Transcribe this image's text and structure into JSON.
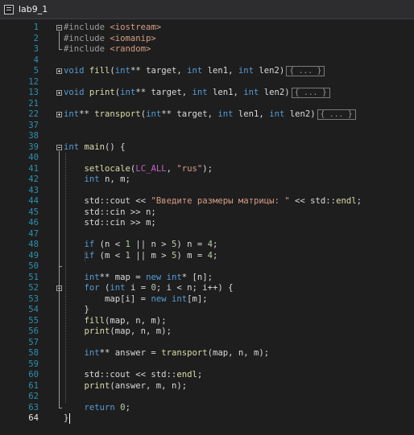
{
  "tab": {
    "title": "lab9_1",
    "icon": "cpp-file-icon"
  },
  "lines": [
    {
      "n": "1",
      "fold": "minus",
      "tokens": [
        [
          "pp",
          "#include "
        ],
        [
          "str",
          "<iostream>"
        ]
      ]
    },
    {
      "n": "2",
      "tokens": [
        [
          "pp",
          "#include "
        ],
        [
          "str",
          "<iomanip>"
        ]
      ]
    },
    {
      "n": "3",
      "tokens": [
        [
          "pp",
          "#include "
        ],
        [
          "str",
          "<random>"
        ]
      ]
    },
    {
      "n": "4",
      "tokens": []
    },
    {
      "n": "5",
      "fold": "plus",
      "tokens": [
        [
          "kw",
          "void "
        ],
        [
          "fn",
          "fill"
        ],
        [
          "id",
          "("
        ],
        [
          "kw",
          "int"
        ],
        [
          "id",
          "** target, "
        ],
        [
          "kw",
          "int"
        ],
        [
          "id",
          " len1, "
        ],
        [
          "kw",
          "int"
        ],
        [
          "id",
          " len2)"
        ],
        [
          "collapsed",
          "{ ... }"
        ]
      ]
    },
    {
      "n": "12",
      "tokens": []
    },
    {
      "n": "13",
      "fold": "plus",
      "tokens": [
        [
          "kw",
          "void "
        ],
        [
          "fn",
          "print"
        ],
        [
          "id",
          "("
        ],
        [
          "kw",
          "int"
        ],
        [
          "id",
          "** target, "
        ],
        [
          "kw",
          "int"
        ],
        [
          "id",
          " len1, "
        ],
        [
          "kw",
          "int"
        ],
        [
          "id",
          " len2)"
        ],
        [
          "collapsed",
          "{ ... }"
        ]
      ]
    },
    {
      "n": "21",
      "tokens": []
    },
    {
      "n": "22",
      "fold": "plus",
      "tokens": [
        [
          "kw",
          "int"
        ],
        [
          "id",
          "** "
        ],
        [
          "fn",
          "transport"
        ],
        [
          "id",
          "("
        ],
        [
          "kw",
          "int"
        ],
        [
          "id",
          "** target, "
        ],
        [
          "kw",
          "int"
        ],
        [
          "id",
          " len1, "
        ],
        [
          "kw",
          "int"
        ],
        [
          "id",
          " len2)"
        ],
        [
          "collapsed",
          "{ ... }"
        ]
      ]
    },
    {
      "n": "37",
      "tokens": []
    },
    {
      "n": "38",
      "tokens": []
    },
    {
      "n": "39",
      "fold": "minus",
      "tokens": [
        [
          "kw",
          "int "
        ],
        [
          "fn",
          "main"
        ],
        [
          "id",
          "() {"
        ]
      ]
    },
    {
      "n": "40",
      "tokens": []
    },
    {
      "n": "41",
      "tokens": [
        [
          "id",
          "    "
        ],
        [
          "fn",
          "setlocale"
        ],
        [
          "id",
          "("
        ],
        [
          "mac",
          "LC_ALL"
        ],
        [
          "id",
          ", "
        ],
        [
          "str",
          "\"rus\""
        ],
        [
          "id",
          ");"
        ]
      ]
    },
    {
      "n": "42",
      "tokens": [
        [
          "id",
          "    "
        ],
        [
          "kw",
          "int "
        ],
        [
          "id",
          "n, m;"
        ]
      ]
    },
    {
      "n": "43",
      "tokens": []
    },
    {
      "n": "44",
      "tokens": [
        [
          "id",
          "    std::"
        ],
        [
          "id",
          "cout << "
        ],
        [
          "str",
          "\"Введите размеры матрицы: \""
        ],
        [
          "id",
          " << std::"
        ],
        [
          "fn",
          "endl"
        ],
        [
          "id",
          ";"
        ]
      ]
    },
    {
      "n": "45",
      "tokens": [
        [
          "id",
          "    std::cin >> n;"
        ]
      ]
    },
    {
      "n": "46",
      "tokens": [
        [
          "id",
          "    std::cin >> m;"
        ]
      ]
    },
    {
      "n": "47",
      "tokens": []
    },
    {
      "n": "48",
      "tokens": [
        [
          "id",
          "    "
        ],
        [
          "kw",
          "if "
        ],
        [
          "id",
          "(n < "
        ],
        [
          "num",
          "1"
        ],
        [
          "id",
          " || n > "
        ],
        [
          "num",
          "5"
        ],
        [
          "id",
          ") n = "
        ],
        [
          "num",
          "4"
        ],
        [
          "id",
          ";"
        ]
      ]
    },
    {
      "n": "49",
      "tokens": [
        [
          "id",
          "    "
        ],
        [
          "kw",
          "if "
        ],
        [
          "id",
          "(m < "
        ],
        [
          "num",
          "1"
        ],
        [
          "id",
          " || m > "
        ],
        [
          "num",
          "5"
        ],
        [
          "id",
          ") m = "
        ],
        [
          "num",
          "4"
        ],
        [
          "id",
          ";"
        ]
      ]
    },
    {
      "n": "50",
      "tokens": []
    },
    {
      "n": "51",
      "tokens": [
        [
          "id",
          "    "
        ],
        [
          "kw",
          "int"
        ],
        [
          "id",
          "** map = "
        ],
        [
          "kw",
          "new int"
        ],
        [
          "id",
          "* [n];"
        ]
      ]
    },
    {
      "n": "52",
      "fold": "minus",
      "tokens": [
        [
          "id",
          "    "
        ],
        [
          "kw",
          "for "
        ],
        [
          "id",
          "("
        ],
        [
          "kw",
          "int"
        ],
        [
          "id",
          " i = "
        ],
        [
          "num",
          "0"
        ],
        [
          "id",
          "; i < n; i++) {"
        ]
      ]
    },
    {
      "n": "53",
      "tokens": [
        [
          "id",
          "        map[i] = "
        ],
        [
          "kw",
          "new int"
        ],
        [
          "id",
          "[m];"
        ]
      ]
    },
    {
      "n": "54",
      "tokens": [
        [
          "id",
          "    }"
        ]
      ]
    },
    {
      "n": "55",
      "tokens": [
        [
          "id",
          "    "
        ],
        [
          "fn",
          "fill"
        ],
        [
          "id",
          "(map, n, m);"
        ]
      ]
    },
    {
      "n": "56",
      "tokens": [
        [
          "id",
          "    "
        ],
        [
          "fn",
          "print"
        ],
        [
          "id",
          "(map, n, m);"
        ]
      ]
    },
    {
      "n": "57",
      "tokens": []
    },
    {
      "n": "58",
      "tokens": [
        [
          "id",
          "    "
        ],
        [
          "kw",
          "int"
        ],
        [
          "id",
          "** answer = "
        ],
        [
          "fn",
          "transport"
        ],
        [
          "id",
          "(map, n, m);"
        ]
      ]
    },
    {
      "n": "59",
      "tokens": []
    },
    {
      "n": "60",
      "tokens": [
        [
          "id",
          "    std::cout << std::"
        ],
        [
          "fn",
          "endl"
        ],
        [
          "id",
          ";"
        ]
      ]
    },
    {
      "n": "61",
      "tokens": [
        [
          "id",
          "    "
        ],
        [
          "fn",
          "print"
        ],
        [
          "id",
          "(answer, m, n);"
        ]
      ]
    },
    {
      "n": "62",
      "tokens": []
    },
    {
      "n": "63",
      "tokens": [
        [
          "id",
          "    "
        ],
        [
          "kw",
          "return "
        ],
        [
          "num",
          "0"
        ],
        [
          "id",
          ";"
        ]
      ]
    },
    {
      "n": "64",
      "current": true,
      "tokens": [
        [
          "id",
          "}"
        ]
      ]
    }
  ]
}
